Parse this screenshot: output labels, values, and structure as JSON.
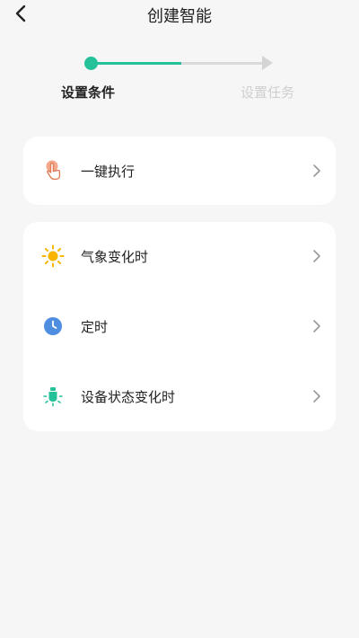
{
  "header": {
    "title": "创建智能",
    "back_icon": "chevron-left-icon"
  },
  "stepper": {
    "steps": [
      {
        "label": "设置条件",
        "state": "active"
      },
      {
        "label": "设置任务",
        "state": "inactive"
      }
    ],
    "accent_color": "#25c29a",
    "inactive_color": "#dadada"
  },
  "manual_card": {
    "items": [
      {
        "label": "一键执行",
        "icon": "tap-hand-icon"
      }
    ]
  },
  "condition_card": {
    "items": [
      {
        "label": "气象变化时",
        "icon": "sun-icon"
      },
      {
        "label": "定时",
        "icon": "clock-icon"
      },
      {
        "label": "设备状态变化时",
        "icon": "device-bulb-icon"
      }
    ]
  }
}
